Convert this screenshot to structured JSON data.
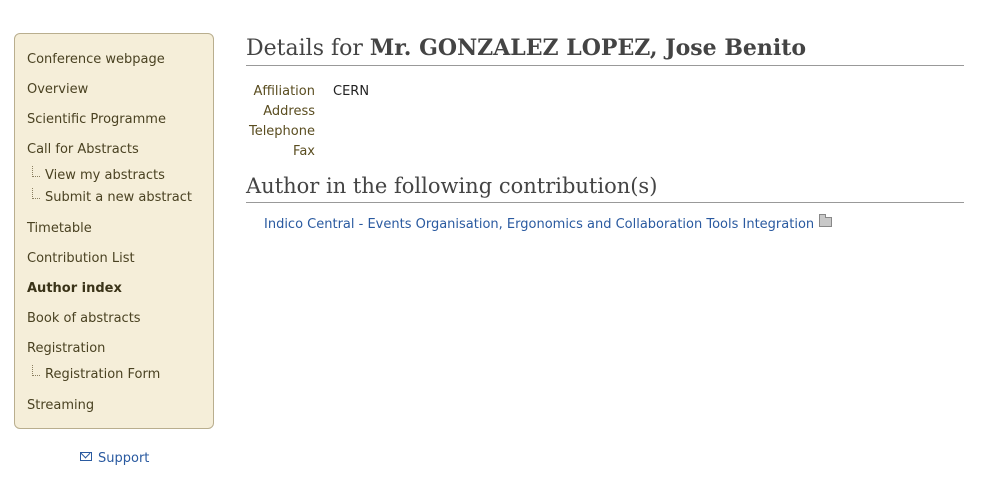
{
  "sidebar": {
    "items": [
      {
        "label": "Conference webpage"
      },
      {
        "label": "Overview"
      },
      {
        "label": "Scientific Programme"
      },
      {
        "label": "Call for Abstracts",
        "children": [
          {
            "label": "View my abstracts"
          },
          {
            "label": "Submit a new abstract"
          }
        ]
      },
      {
        "label": "Timetable"
      },
      {
        "label": "Contribution List"
      },
      {
        "label": "Author index"
      },
      {
        "label": "Book of abstracts"
      },
      {
        "label": "Registration",
        "children": [
          {
            "label": "Registration Form"
          }
        ]
      },
      {
        "label": "Streaming"
      }
    ],
    "active": "Author index",
    "support_label": "Support"
  },
  "main": {
    "title_prefix": "Details for ",
    "title_name": "Mr. GONZALEZ LOPEZ, Jose Benito",
    "details": [
      {
        "label": "Affiliation",
        "value": "CERN"
      },
      {
        "label": "Address",
        "value": ""
      },
      {
        "label": "Telephone",
        "value": ""
      },
      {
        "label": "Fax",
        "value": ""
      }
    ],
    "contributions_heading": "Author in the following contribution(s)",
    "contributions": [
      {
        "title": "Indico Central - Events Organisation, Ergonomics and Collaboration Tools Integration"
      }
    ]
  },
  "colors": {
    "sidebar_bg": "#f5eed9",
    "link": "#2a5aa0"
  },
  "icons": {
    "support": "envelope-icon",
    "contribution": "folder-icon"
  }
}
